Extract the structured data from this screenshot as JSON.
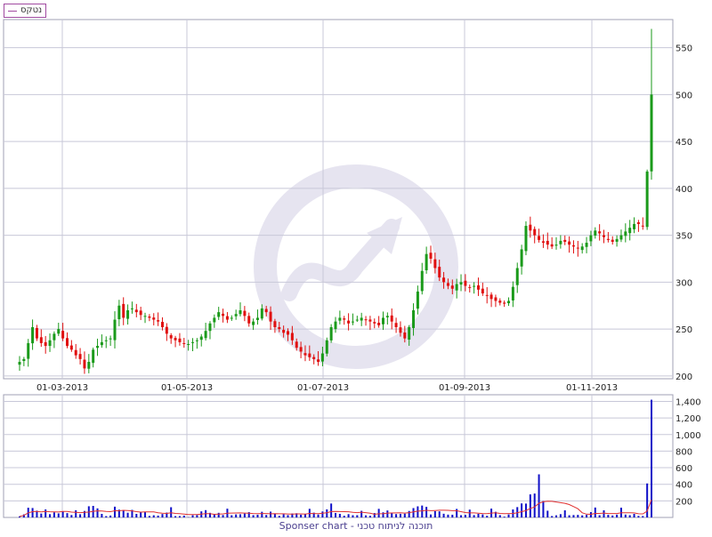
{
  "legend": {
    "label": "נטקס",
    "color": "#a04aa0"
  },
  "footer": {
    "text": "Sponser chart - תוכנה לניתוח טכני"
  },
  "colors": {
    "up": "#1a9a1a",
    "down": "#e01010",
    "volume": "#1010c8",
    "volume_ma": "#e03030",
    "grid": "#c8c8d8",
    "watermark": "#e6e4f0"
  },
  "watermark_icon": "trend-arrow-logo-icon",
  "chart_data": [
    {
      "type": "candlestick",
      "x_tick_labels": [
        "01-03-2013",
        "01-05-2013",
        "01-07-2013",
        "01-09-2013",
        "01-11-2013"
      ],
      "y_ticks": [
        200,
        250,
        300,
        350,
        400,
        450,
        500,
        550
      ],
      "ylim": [
        197,
        580
      ],
      "grid": true,
      "closes": [
        215,
        218,
        235,
        252,
        240,
        235,
        232,
        238,
        245,
        250,
        240,
        232,
        228,
        222,
        218,
        208,
        215,
        228,
        232,
        236,
        238,
        240,
        260,
        275,
        262,
        270,
        272,
        268,
        265,
        264,
        262,
        260,
        258,
        252,
        245,
        240,
        238,
        236,
        234,
        234,
        236,
        238,
        242,
        248,
        256,
        262,
        268,
        264,
        260,
        262,
        266,
        270,
        264,
        256,
        258,
        262,
        272,
        268,
        258,
        252,
        250,
        246,
        244,
        238,
        230,
        226,
        222,
        220,
        218,
        215,
        224,
        238,
        252,
        258,
        262,
        260,
        256,
        258,
        260,
        262,
        260,
        258,
        256,
        254,
        262,
        264,
        258,
        252,
        246,
        240,
        252,
        270,
        290,
        312,
        330,
        325,
        315,
        305,
        300,
        296,
        293,
        298,
        300,
        296,
        294,
        296,
        292,
        288,
        286,
        282,
        280,
        278,
        277,
        280,
        295,
        315,
        335,
        360,
        355,
        350,
        345,
        342,
        340,
        338,
        340,
        344,
        343,
        340,
        338,
        336,
        338,
        342,
        350,
        355,
        352,
        348,
        345,
        343,
        346,
        350,
        354,
        358,
        362,
        362,
        360,
        418,
        500
      ],
      "volume": {
        "y_ticks": [
          200,
          400,
          600,
          800,
          1000,
          1200,
          1400
        ],
        "ylim": [
          0,
          1480
        ]
      }
    }
  ]
}
